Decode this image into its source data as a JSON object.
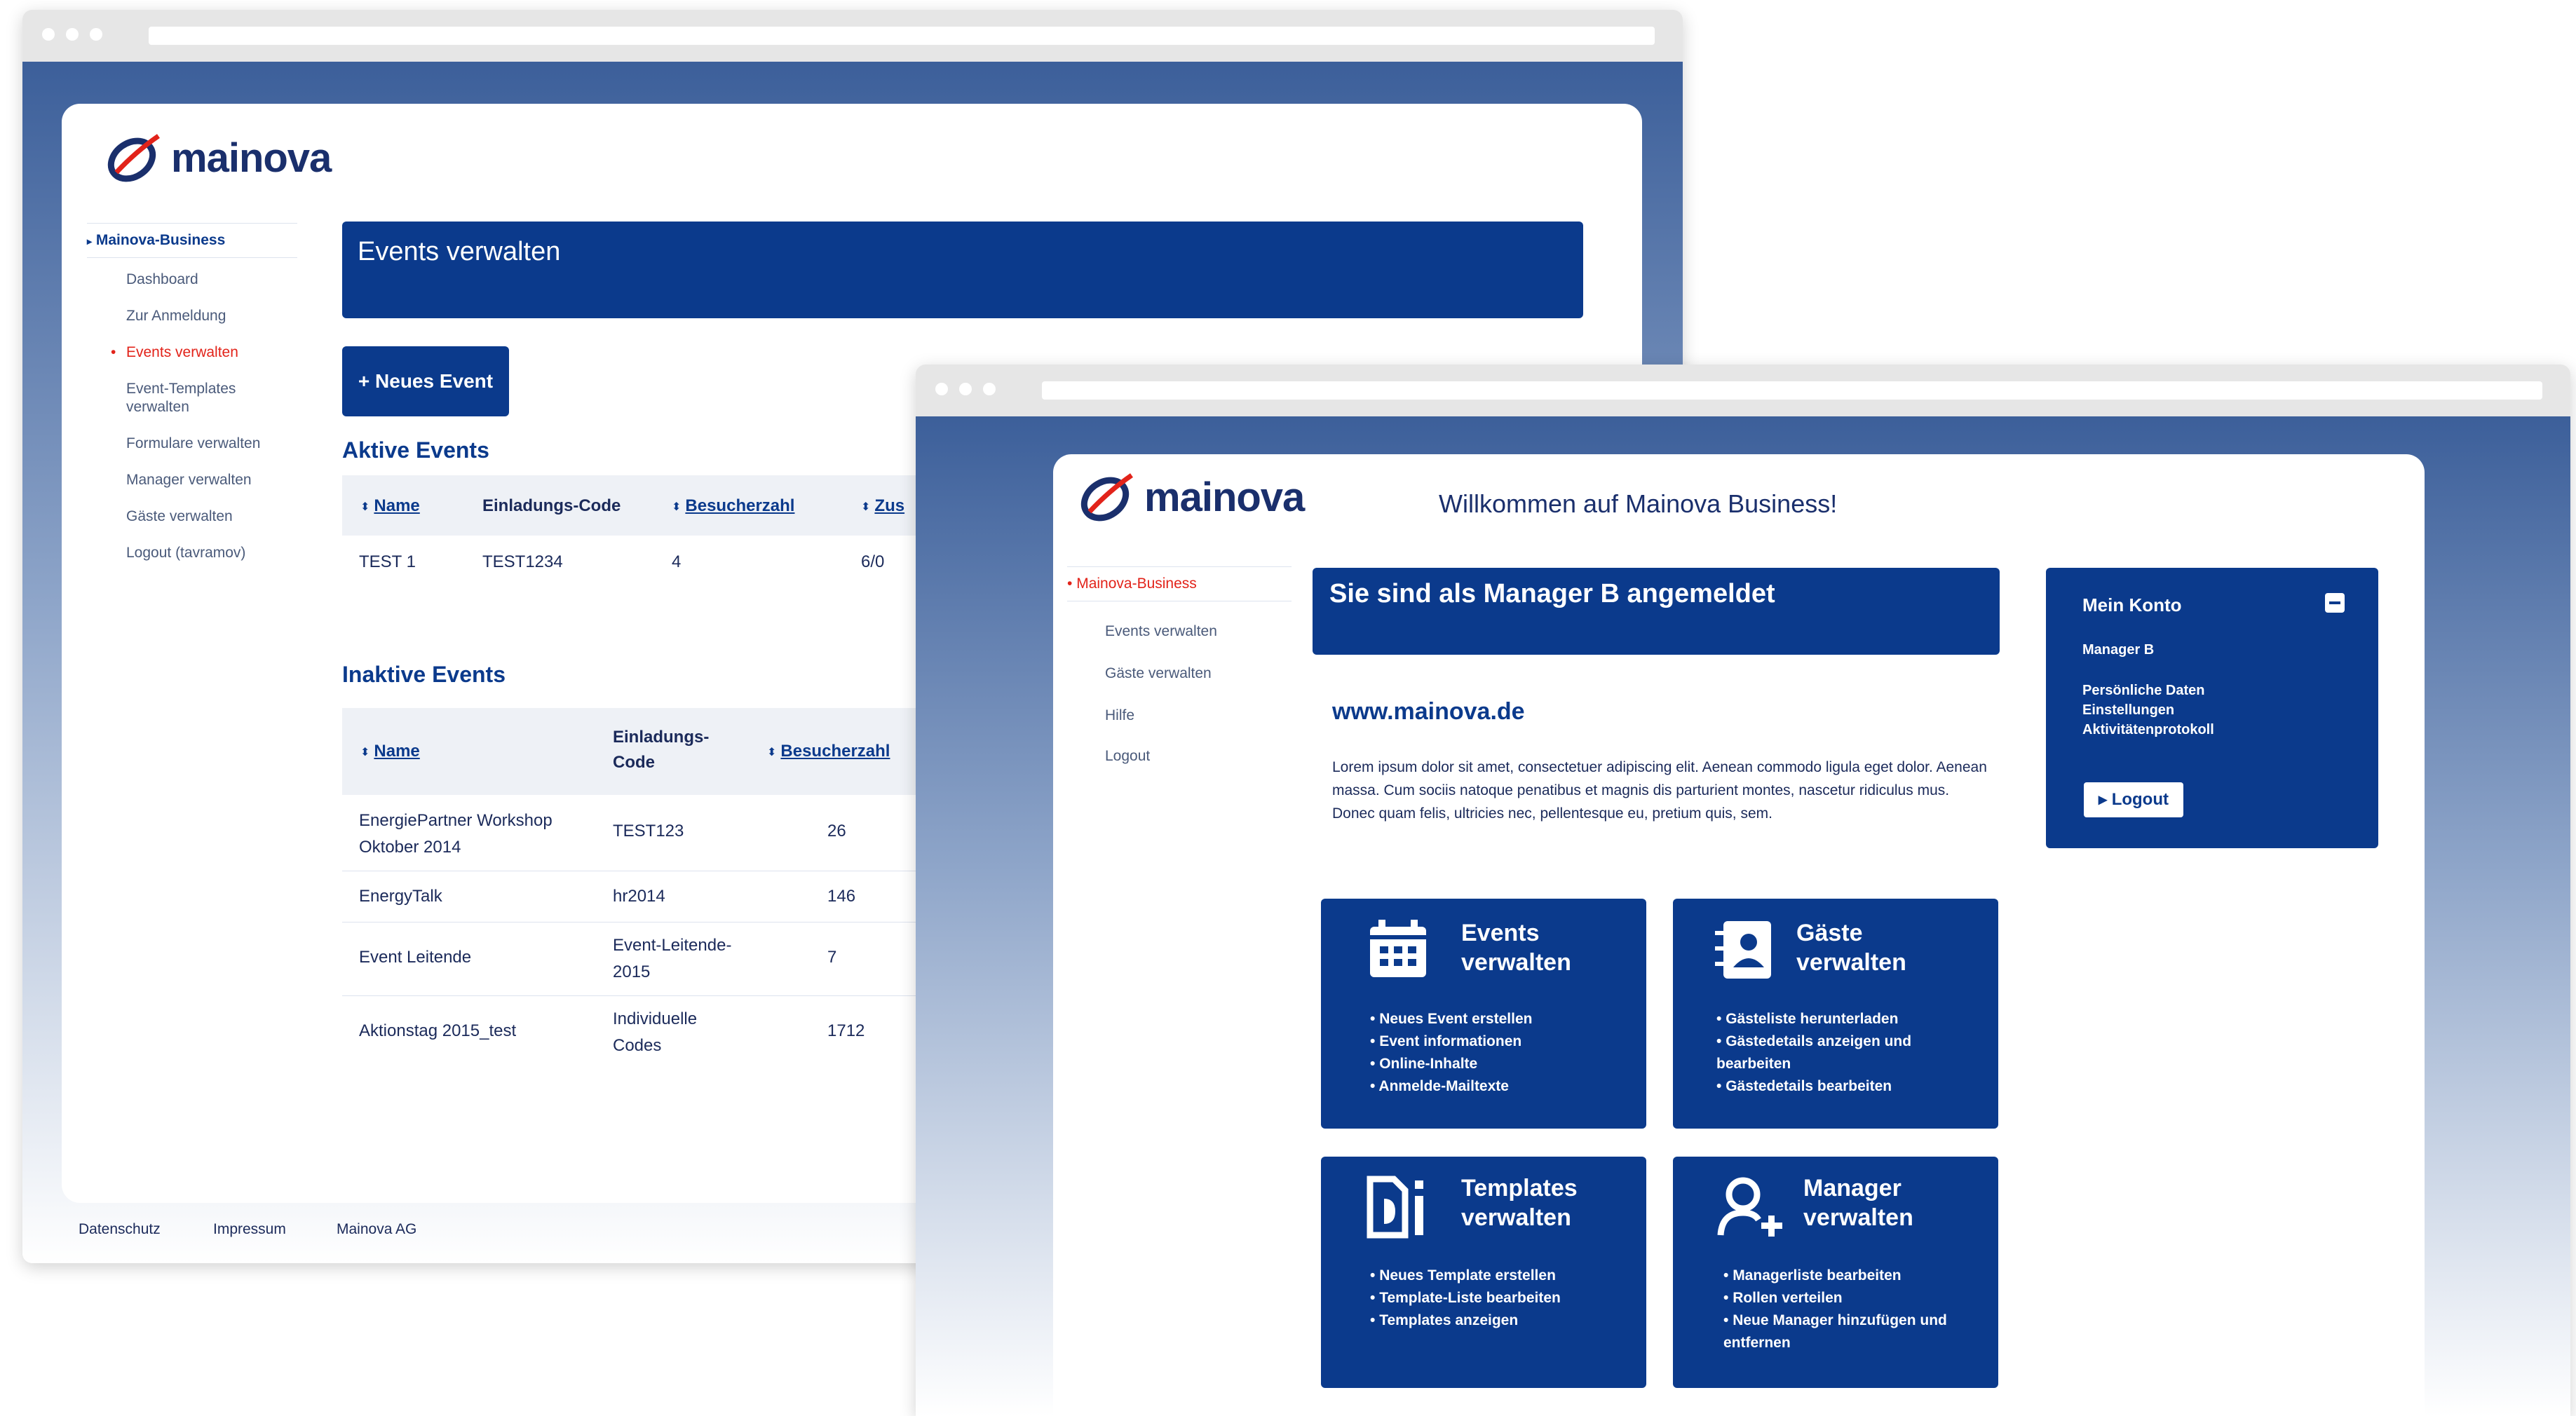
{
  "left": {
    "logo": "mainova",
    "nav": {
      "section": "Mainova-Business",
      "items": [
        "Dashboard",
        "Zur Anmeldung",
        "Events verwalten",
        "Event-Templates verwalten",
        "Formulare verwalten",
        "Manager verwalten",
        "Gäste verwalten",
        "Logout (tavramov)"
      ],
      "active_index": 2
    },
    "header_title": "Events verwalten",
    "new_event_button": "+ Neues Event",
    "active": {
      "title": "Aktive Events",
      "headers": [
        "Name",
        "Einladungs-Code",
        "Besucherzahl",
        "Zus"
      ],
      "rows": [
        [
          "TEST 1",
          "TEST1234",
          "4",
          "6/0"
        ]
      ]
    },
    "inactive": {
      "title": "Inaktive Events",
      "headers": [
        "Name",
        "Einladungs-Code",
        "Besucherzahl"
      ],
      "rows": [
        [
          "EnergiePartner Workshop Oktober 2014",
          "TEST123",
          "26"
        ],
        [
          "EnergyTalk",
          "hr2014",
          "146"
        ],
        [
          "Event Leitende",
          "Event-Leitende-2015",
          "7"
        ],
        [
          "Aktionstag 2015_test",
          "Individuelle Codes",
          "1712"
        ]
      ]
    },
    "footer": [
      "Datenschutz",
      "Impressum",
      "Mainova AG"
    ]
  },
  "right": {
    "logo": "mainova",
    "welcome": "Willkommen auf Mainova Business!",
    "nav": {
      "section": "Mainova-Business",
      "items": [
        "Events verwalten",
        "Gäste verwalten",
        "Hilfe",
        "Logout"
      ]
    },
    "banner": "Sie sind als Manager B angemeldet",
    "website": "www.mainova.de",
    "lorem": "Lorem ipsum dolor sit amet, consectetuer adipiscing elit. Aenean commodo ligula eget dolor. Aenean massa. Cum sociis natoque penatibus et magnis dis parturient montes, nascetur ridiculus mus. Donec quam felis, ultricies nec, pellentesque eu, pretium quis, sem.",
    "account": {
      "title": "Mein Konto",
      "user": "Manager B",
      "links": [
        "Persönliche Daten",
        "Einstellungen",
        "Aktivitätenprotokoll"
      ],
      "logout": "▸ Logout"
    },
    "tiles": [
      {
        "icon": "calendar-icon",
        "title": "Events verwalten",
        "items": [
          "Neues Event erstellen",
          "Event informationen",
          "Online-Inhalte",
          "Anmelde-Mailtexte"
        ]
      },
      {
        "icon": "contact-card-icon",
        "title": "Gäste verwalten",
        "items": [
          "Gästeliste herunterladen",
          "Gästedetails anzeigen und bearbeiten",
          "Gästedetails bearbeiten"
        ]
      },
      {
        "icon": "document-icon",
        "title": "Templates verwalten",
        "items": [
          "Neues Template erstellen",
          "Template-Liste bearbeiten",
          "Templates anzeigen"
        ]
      },
      {
        "icon": "add-user-icon",
        "title": "Manager verwalten",
        "items": [
          "Managerliste bearbeiten",
          "Rollen verteilen",
          "Neue Manager hinzufügen und entfernen"
        ]
      }
    ]
  },
  "colors": {
    "brand_navy": "#0b3a8c",
    "active_red": "#e2231a",
    "logo_text": "#1a2f6c"
  }
}
